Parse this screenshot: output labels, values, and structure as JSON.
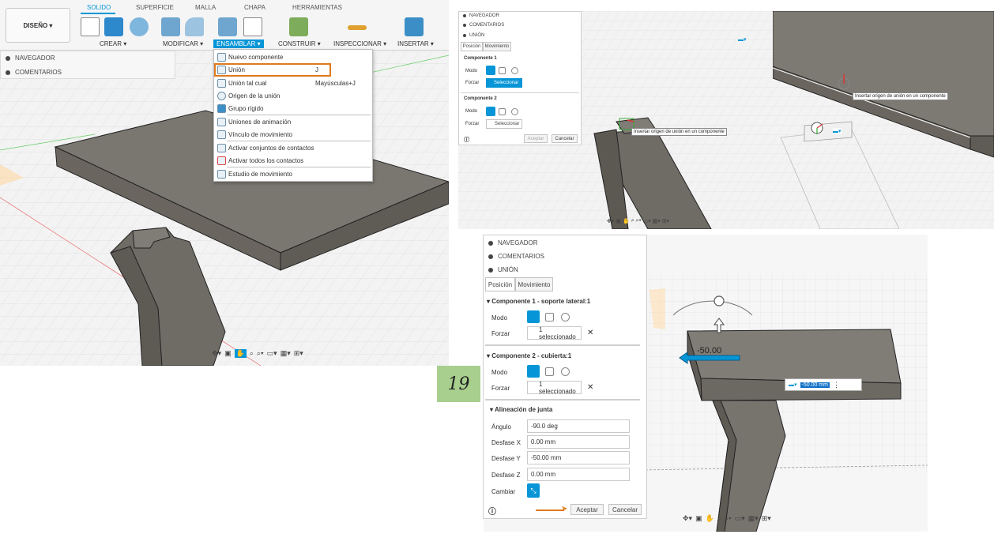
{
  "ribbon": {
    "tabs": [
      "SOLIDO",
      "SUPERFICIE",
      "MALLA",
      "CHAPA",
      "HERRAMIENTAS"
    ],
    "design": "DISEÑO ▾",
    "groups": [
      "CREAR ▾",
      "MODIFICAR ▾",
      "ENSAMBLAR ▾",
      "CONSTRUIR ▾",
      "INSPECCIONAR ▾",
      "INSERTAR ▾"
    ]
  },
  "browser_a": {
    "items": [
      "NAVEGADOR",
      "COMENTARIOS"
    ]
  },
  "menu": {
    "items": [
      "Nuevo componente",
      "Unión",
      "Unión tal cual",
      "Origen de la unión",
      "Grupo rígido",
      "Uniones de animación",
      "Vínculo de movimiento",
      "Activar conjuntos de contactos",
      "Activar todos los contactos",
      "Estudio de movimiento"
    ],
    "shortcut_union": "J",
    "shortcut_as_is": "Mayúsculas+J"
  },
  "panel_b": {
    "items": [
      "NAVEGADOR",
      "COMENTARIOS",
      "UNIÓN"
    ],
    "tabs": [
      "Posición",
      "Movimiento"
    ],
    "comp1": "Componente 1",
    "comp2": "Componente 2",
    "mode": "Modo",
    "force": "Forzar",
    "select": "Seleccionar",
    "ok": "Aceptar",
    "cancel": "Cancelar"
  },
  "tooltips": {
    "b": "Insertar origen de unión en un componente",
    "c": "Insertar origen de unión en un componente"
  },
  "panel_d": {
    "items": [
      "NAVEGADOR",
      "COMENTARIOS",
      "UNIÓN"
    ],
    "tabs": [
      "Posición",
      "Movimiento"
    ],
    "comp1": "Componente 1 - soporte lateral:1",
    "comp2": "Componente 2 - cubierta:1",
    "mode": "Modo",
    "force": "Forzar",
    "selected": "1 seleccionado",
    "align_title": "Alineación de junta",
    "fields": [
      {
        "label": "Ángulo",
        "value": "-90.0 deg"
      },
      {
        "label": "Desfase X",
        "value": "0.00 mm"
      },
      {
        "label": "Desfase Y",
        "value": "-50.00 mm"
      },
      {
        "label": "Desfase Z",
        "value": "0.00 mm"
      }
    ],
    "change": "Cambiar",
    "ok": "Aceptar",
    "cancel": "Cancelar"
  },
  "step_number": "19",
  "viewport_d": {
    "dim_label": "-50.00",
    "dim_input": "-50.00 mm"
  },
  "colors": {
    "accent": "#0696d7",
    "highlight": "#e07a1a",
    "step_bg": "#a8cf8e",
    "plate": "#7a7670"
  }
}
